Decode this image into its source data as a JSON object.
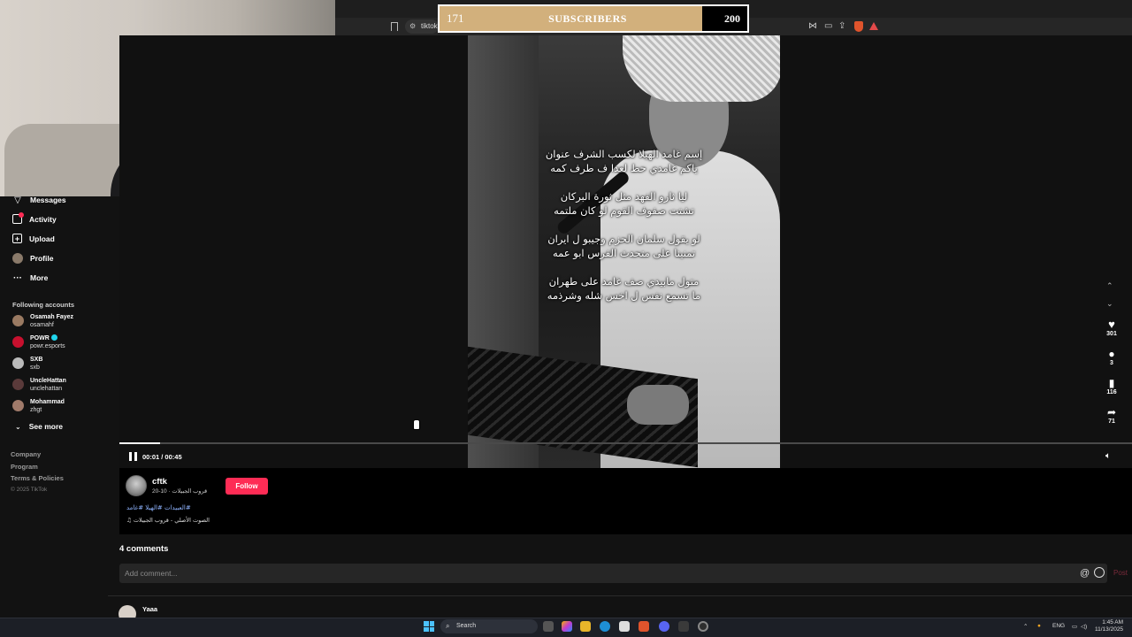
{
  "overlay": {
    "subs_current": "171",
    "subs_label": "SUBSCRIBERS",
    "subs_goal": "200"
  },
  "browser": {
    "url_text": "tiktok"
  },
  "sidebar": {
    "nav": [
      {
        "label": "Messages",
        "icon": "paper-plane-icon"
      },
      {
        "label": "Activity",
        "icon": "inbox-icon"
      },
      {
        "label": "Upload",
        "icon": "plus-square-icon"
      },
      {
        "label": "Profile",
        "icon": "profile-avatar-icon"
      },
      {
        "label": "More",
        "icon": "more-dots-icon"
      }
    ],
    "following_label": "Following accounts",
    "accounts": [
      {
        "name": "Osamah Fayez",
        "handle": "osamahf",
        "verified": false
      },
      {
        "name": "POWR",
        "handle": "powr.esports",
        "verified": true
      },
      {
        "name": "SXB",
        "handle": "sxb",
        "verified": false
      },
      {
        "name": "UncleHattan",
        "handle": "unclehattan",
        "verified": false
      },
      {
        "name": "Mohammad",
        "handle": "zhgt",
        "verified": false
      }
    ],
    "see_more": "See more",
    "footer": [
      "Company",
      "Program",
      "Terms & Policies"
    ],
    "copyright": "© 2025 TikTok"
  },
  "video": {
    "lyrics": [
      [
        "إسم غامد الهيلا لكسب الشرف عنوان",
        "ياكم غامدي حط لعدا ف طرف كمه"
      ],
      [
        "ليا ثارو الفهد مثل ثورة البركان",
        "تشتت صفوف القوم لو كان ملتمه"
      ],
      [
        "لو يقول سلمان الحزم وجيبو ل ايران",
        "تمنينا على متحدث الفرس ابو عمه"
      ],
      [
        "متول مابيدي صف غامد على طهران",
        "ما تسمع نفس ل اخس شله وشرذمه"
      ]
    ],
    "time": "00:01 / 00:45",
    "progress_fraction": 0.04
  },
  "actions": {
    "likes": "301",
    "comments": "3",
    "saves": "116",
    "shares": "71"
  },
  "author": {
    "name": "cftk",
    "sub": "قروب الجبيلات · 10-20",
    "follow_label": "Follow",
    "hashtags": "#العبيدات #الهيلا #غامد",
    "sound": "♫ الصوت الأصلي - قروب الجبيلات"
  },
  "comments": {
    "title": "4 comments",
    "placeholder": "Add comment...",
    "at": "@",
    "post": "Post",
    "first_name": "Yaaa"
  },
  "taskbar": {
    "search": "Search",
    "lang": "ENG",
    "time": "1:45 AM",
    "date": "11/13/2025"
  }
}
